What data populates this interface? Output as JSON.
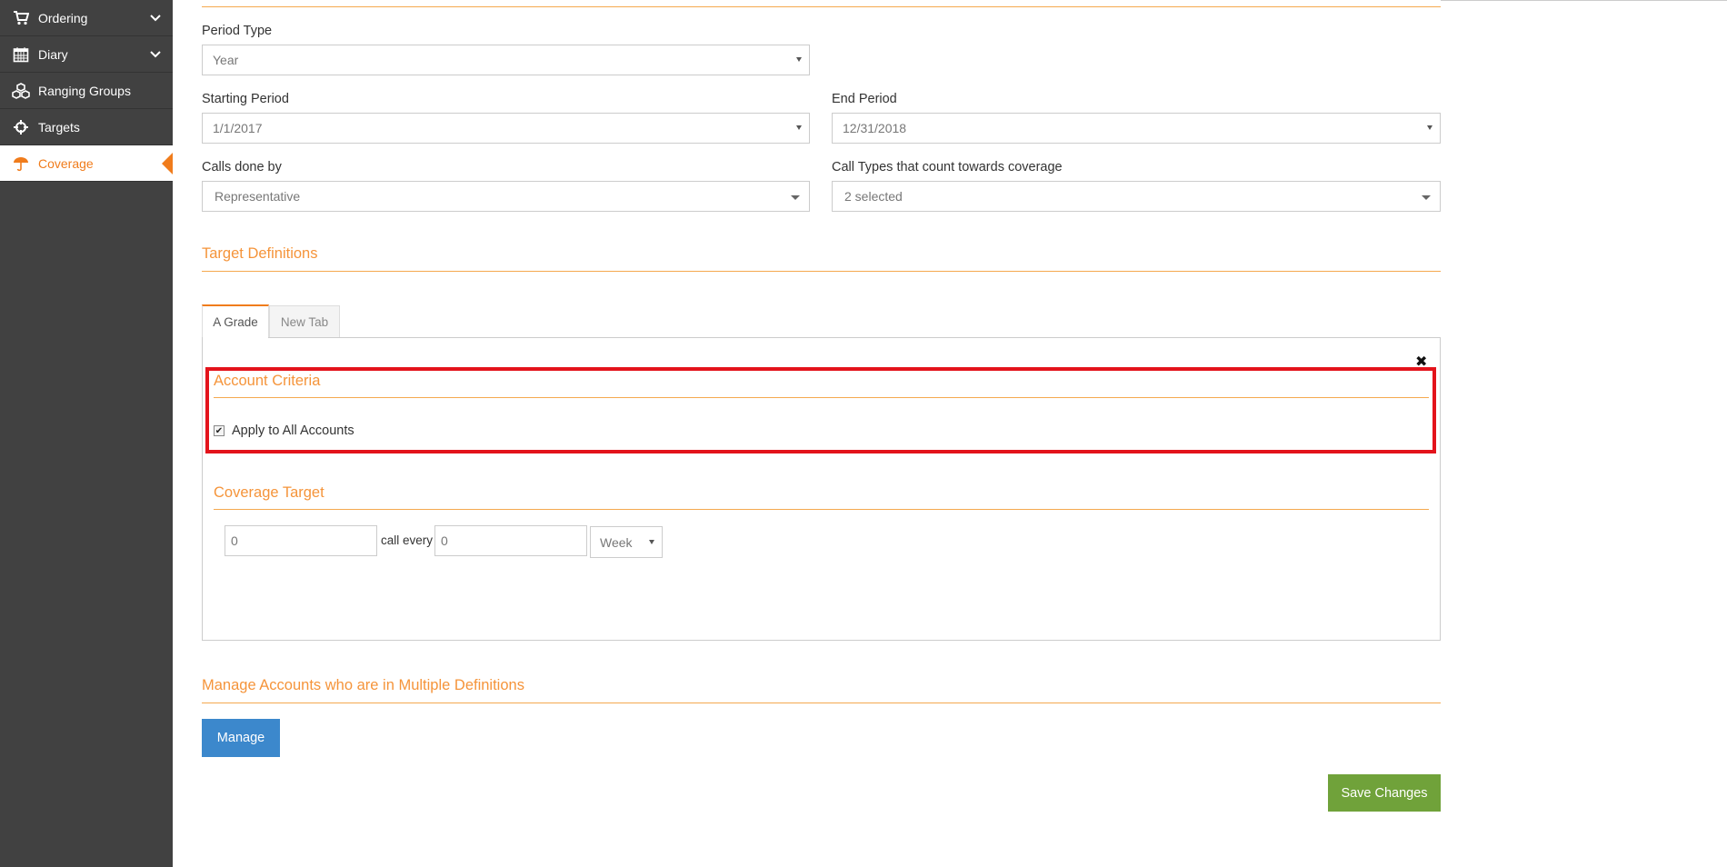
{
  "sidebar": {
    "items": [
      {
        "label": "Ordering",
        "icon": "cart-icon",
        "has_chevron": true
      },
      {
        "label": "Diary",
        "icon": "calendar-icon",
        "has_chevron": true
      },
      {
        "label": "Ranging Groups",
        "icon": "cubes-icon",
        "has_chevron": false
      },
      {
        "label": "Targets",
        "icon": "crosshair-icon",
        "has_chevron": false
      },
      {
        "label": "Coverage",
        "icon": "umbrella-icon",
        "has_chevron": false,
        "active": true
      }
    ]
  },
  "form": {
    "period_type": {
      "label": "Period Type",
      "value": "Year"
    },
    "starting_period": {
      "label": "Starting Period",
      "value": "1/1/2017"
    },
    "end_period": {
      "label": "End Period",
      "value": "12/31/2018"
    },
    "calls_done_by": {
      "label": "Calls done by",
      "value": "Representative"
    },
    "call_types": {
      "label": "Call Types that count towards coverage",
      "value": "2 selected"
    }
  },
  "target_definitions": {
    "title": "Target Definitions",
    "tabs": [
      {
        "label": "A Grade",
        "active": true
      },
      {
        "label": "New Tab",
        "active": false
      }
    ],
    "close_glyph": "✖",
    "account_criteria": {
      "title": "Account Criteria",
      "apply_all_label": "Apply to All Accounts",
      "apply_all_checked": true,
      "check_glyph": "✔"
    },
    "coverage_target": {
      "title": "Coverage Target",
      "calls_value": "0",
      "call_every_text": "call every",
      "every_value": "0",
      "unit": "Week"
    }
  },
  "manage_section": {
    "title": "Manage Accounts who are in Multiple Definitions",
    "button_label": "Manage"
  },
  "save_button_label": "Save Changes",
  "colors": {
    "accent": "#f07c1c",
    "section_title": "#f5943a",
    "sidebar_bg": "#414141",
    "highlight": "#e3131b",
    "manage_button": "#3c88cc",
    "save_button": "#70a23a"
  }
}
